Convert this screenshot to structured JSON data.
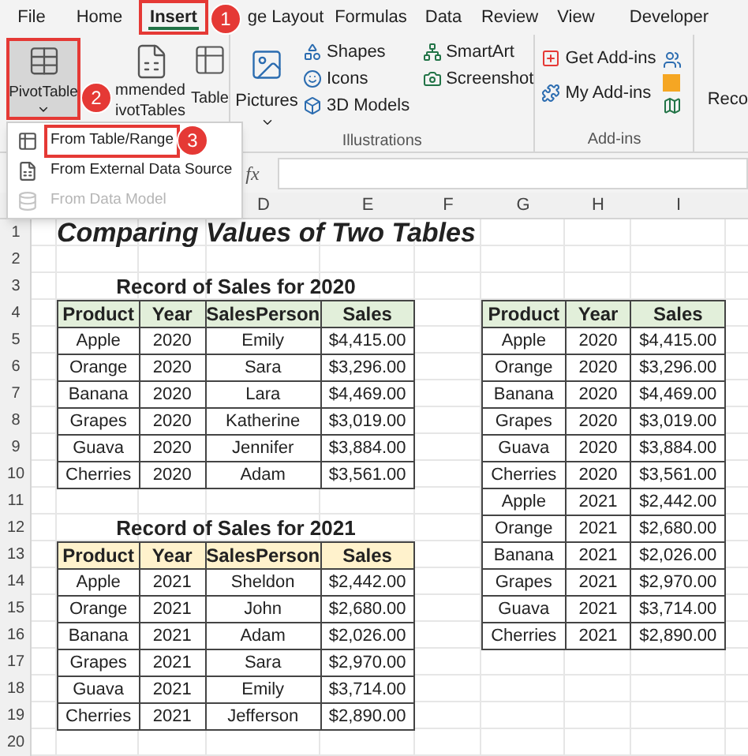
{
  "menu_tabs": [
    {
      "label": "File",
      "selected": false
    },
    {
      "label": "Home",
      "selected": false
    },
    {
      "label": "Insert",
      "selected": true
    },
    {
      "label": "ge Layout",
      "selected": false
    },
    {
      "label": "Formulas",
      "selected": false
    },
    {
      "label": "Data",
      "selected": false
    },
    {
      "label": "Review",
      "selected": false
    },
    {
      "label": "View",
      "selected": false
    },
    {
      "label": "Developer",
      "selected": false
    }
  ],
  "ribbon": {
    "pivot": {
      "label": "PivotTable",
      "selected": true
    },
    "recommended": [
      "mmended",
      "ivotTables"
    ],
    "table": "Table",
    "pictures": "Pictures",
    "illustration_items": [
      "Shapes",
      "Icons",
      "3D Models"
    ],
    "graphic_items": [
      "SmartArt",
      "Screenshot"
    ],
    "illustrations_label": "Illustrations",
    "addin_items": [
      "Get Add-ins",
      "My Add-ins"
    ],
    "addins_label": "Add-ins",
    "cut_label": "Reco"
  },
  "dropdown": [
    {
      "label": "From Table/Range",
      "selected": true,
      "disabled": false
    },
    {
      "label": "From External Data Source",
      "selected": false,
      "disabled": false
    },
    {
      "label": "From Data Model",
      "selected": false,
      "disabled": true
    }
  ],
  "step_badges": [
    "1",
    "2",
    "3"
  ],
  "formula_bar": {
    "fx": "fx"
  },
  "sheet": {
    "columns": [
      "D",
      "E",
      "F",
      "G",
      "H",
      "I"
    ],
    "row_numbers": [
      "1",
      "2",
      "3",
      "4",
      "5",
      "6",
      "7",
      "8",
      "9",
      "10",
      "11",
      "12",
      "13",
      "14",
      "15",
      "16",
      "17",
      "18",
      "19",
      "20"
    ],
    "title": "Comparing Values of Two Tables",
    "tables": [
      {
        "caption": "Record of Sales for 2020",
        "color": "#e2efda",
        "headers": [
          "Product",
          "Year",
          "SalesPerson",
          "Sales"
        ],
        "rows": [
          [
            "Apple",
            "2020",
            "Emily",
            "$4,415.00"
          ],
          [
            "Orange",
            "2020",
            "Sara",
            "$3,296.00"
          ],
          [
            "Banana",
            "2020",
            "Lara",
            "$4,469.00"
          ],
          [
            "Grapes",
            "2020",
            "Katherine",
            "$3,019.00"
          ],
          [
            "Guava",
            "2020",
            "Jennifer",
            "$3,884.00"
          ],
          [
            "Cherries",
            "2020",
            "Adam",
            "$3,561.00"
          ]
        ]
      },
      {
        "caption": "Record of Sales for 2021",
        "color": "#fff2cc",
        "headers": [
          "Product",
          "Year",
          "SalesPerson",
          "Sales"
        ],
        "rows": [
          [
            "Apple",
            "2021",
            "Sheldon",
            "$2,442.00"
          ],
          [
            "Orange",
            "2021",
            "John",
            "$2,680.00"
          ],
          [
            "Banana",
            "2021",
            "Adam",
            "$2,026.00"
          ],
          [
            "Grapes",
            "2021",
            "Sara",
            "$2,970.00"
          ],
          [
            "Guava",
            "2021",
            "Emily",
            "$3,714.00"
          ],
          [
            "Cherries",
            "2021",
            "Jefferson",
            "$2,890.00"
          ]
        ]
      },
      {
        "color": "#e2efda",
        "headers": [
          "Product",
          "Year",
          "Sales"
        ],
        "rows": [
          [
            "Apple",
            "2020",
            "$4,415.00"
          ],
          [
            "Orange",
            "2020",
            "$3,296.00"
          ],
          [
            "Banana",
            "2020",
            "$4,469.00"
          ],
          [
            "Grapes",
            "2020",
            "$3,019.00"
          ],
          [
            "Guava",
            "2020",
            "$3,884.00"
          ],
          [
            "Cherries",
            "2020",
            "$3,561.00"
          ],
          [
            "Apple",
            "2021",
            "$2,442.00"
          ],
          [
            "Orange",
            "2021",
            "$2,680.00"
          ],
          [
            "Banana",
            "2021",
            "$2,026.00"
          ],
          [
            "Grapes",
            "2021",
            "$2,970.00"
          ],
          [
            "Guava",
            "2021",
            "$3,714.00"
          ],
          [
            "Cherries",
            "2021",
            "$2,890.00"
          ]
        ]
      }
    ]
  }
}
